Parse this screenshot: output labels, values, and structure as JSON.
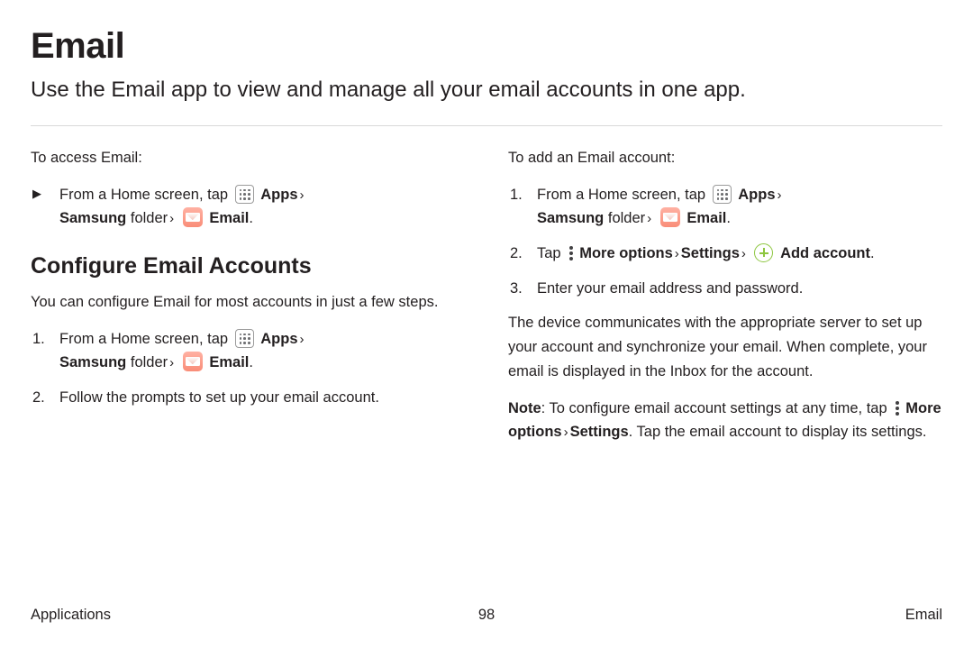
{
  "page": {
    "title": "Email",
    "subtitle": "Use the Email app to view and manage all your email accounts in one app."
  },
  "left_column": {
    "intro": "To access Email:",
    "bullet": {
      "marker": "▶",
      "text_1": "From a Home screen, tap",
      "apps_label": "Apps",
      "chevron": "›",
      "samsung_label": "Samsung",
      "folder_label": "folder",
      "email_label": "Email",
      "period": "."
    },
    "heading": "Configure Email Accounts",
    "paragraph": "You can configure Email for most accounts in just a few steps.",
    "steps": [
      {
        "number": "1.",
        "text_1": "From a Home screen, tap",
        "apps_label": "Apps",
        "chevron": "›",
        "samsung_label": "Samsung",
        "folder_label": "folder",
        "email_label": "Email",
        "period": "."
      },
      {
        "number": "2.",
        "text": "Follow the prompts to set up your email account."
      }
    ]
  },
  "right_column": {
    "intro": "To add an Email account:",
    "steps": [
      {
        "number": "1.",
        "text_1": "From a Home screen, tap",
        "apps_label": "Apps",
        "chevron": "›",
        "samsung_label": "Samsung",
        "folder_label": "folder",
        "email_label": "Email",
        "period": "."
      },
      {
        "number": "2.",
        "text_1": "Tap",
        "more_options_label": "More options",
        "chevron": "›",
        "settings_label": "Settings",
        "add_account_label": "Add account",
        "period": "."
      },
      {
        "number": "3.",
        "text": "Enter your email address and password."
      }
    ],
    "paragraph": "The device communicates with the appropriate server to set up your account and synchronize your email. When complete, your email is displayed in the Inbox for the account.",
    "note": {
      "label": "Note",
      "text_1": ": To configure email account settings at any time, tap",
      "more_options_label": "More options",
      "chevron": "›",
      "settings_label": "Settings",
      "text_2": ". Tap the email account to display its settings."
    }
  },
  "footer": {
    "left": "Applications",
    "page_number": "98",
    "right": "Email"
  },
  "colors": {
    "text": "#231f20",
    "rule": "#d9d9d9",
    "email_icon": "#f98d78",
    "plus_icon": "#8dc63f"
  }
}
